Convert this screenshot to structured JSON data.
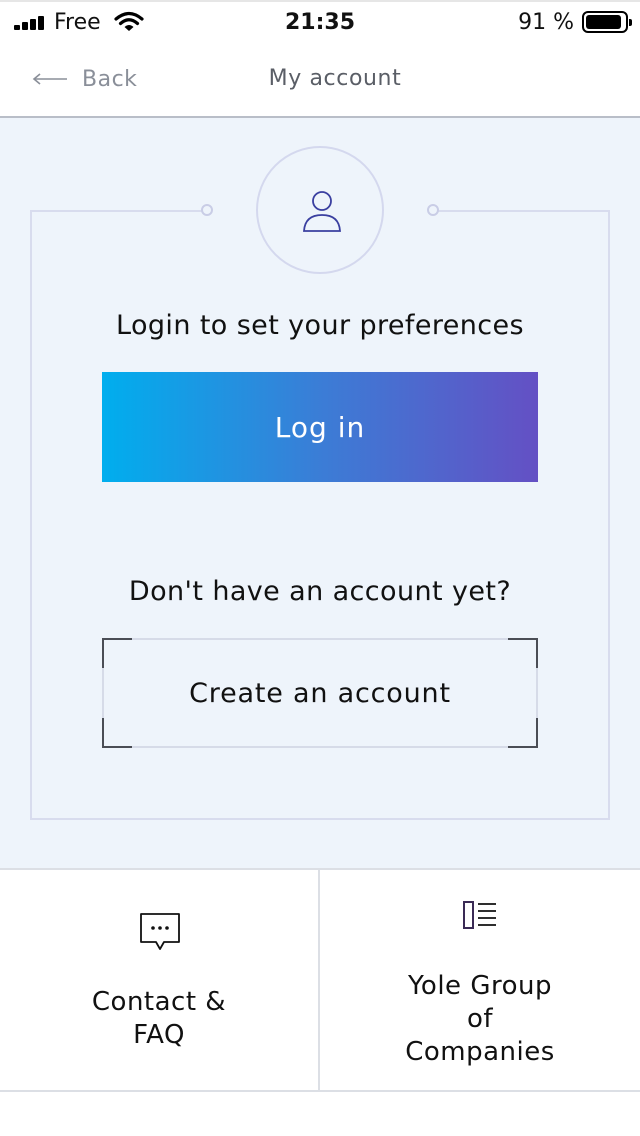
{
  "status_bar": {
    "carrier": "Free",
    "time": "21:35",
    "battery": "91 %",
    "battery_level": 0.91
  },
  "nav": {
    "back_label": "Back",
    "title": "My account"
  },
  "account": {
    "login_prompt": "Login to set your preferences",
    "login_button": "Log in",
    "no_account_prompt": "Don't have an account yet?",
    "create_button": "Create an account"
  },
  "tiles": {
    "contact_line1": "Contact &",
    "contact_line2": "FAQ",
    "yole_line1": "Yole Group",
    "yole_line2": "of",
    "yole_line3": "Companies"
  },
  "icons": {
    "user": "user-icon",
    "chat": "chat-bubble-icon",
    "list": "list-icon",
    "back": "arrow-left-icon"
  },
  "colors": {
    "accent_start": "#00aeee",
    "accent_end": "#6450c4",
    "panel_bg": "#eef4fb"
  }
}
